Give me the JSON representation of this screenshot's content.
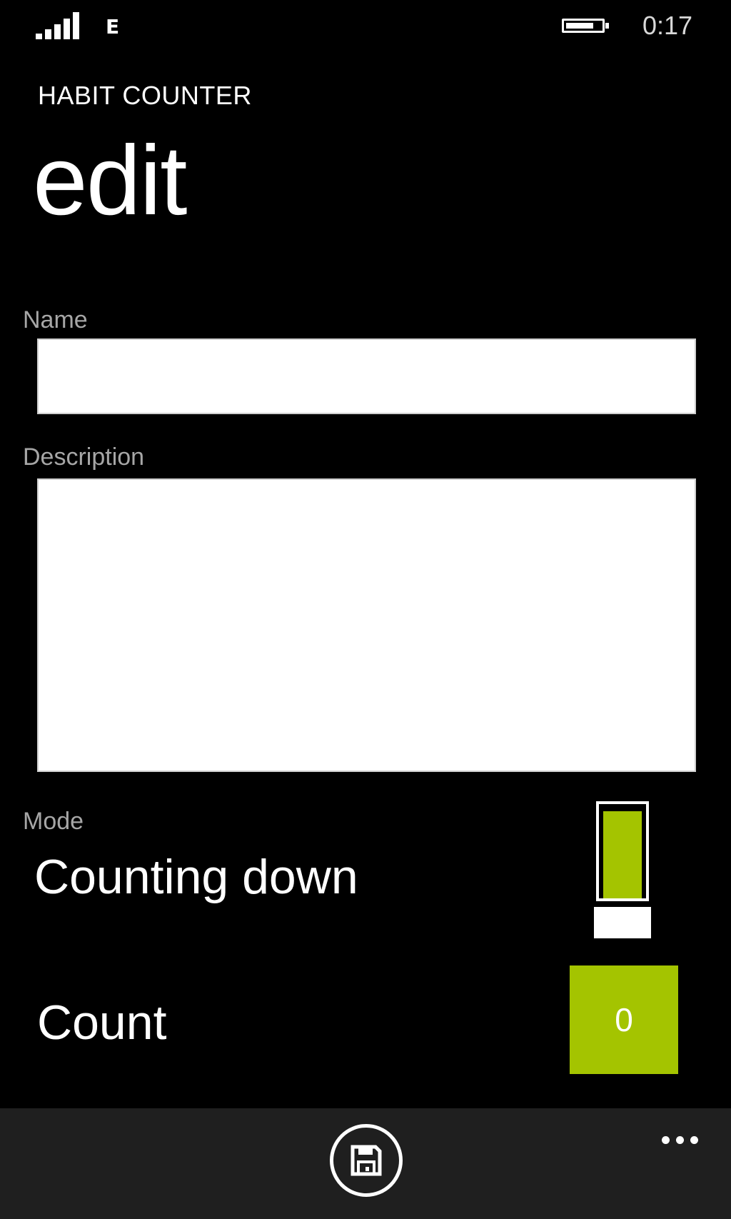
{
  "status_bar": {
    "network_type": "E",
    "time": "0:17",
    "signal_icon": "signal-strength-icon",
    "battery_icon": "battery-icon"
  },
  "header": {
    "app_title": "HABIT COUNTER",
    "page_title": "edit"
  },
  "form": {
    "name": {
      "label": "Name",
      "value": ""
    },
    "description": {
      "label": "Description",
      "value": ""
    },
    "mode": {
      "label": "Mode",
      "value": "Counting down"
    },
    "count": {
      "label": "Count",
      "value": "0"
    }
  },
  "app_bar": {
    "save_icon": "save-icon",
    "more_icon": "more-icon"
  },
  "colors": {
    "accent": "#a4c400",
    "background": "#000000",
    "app_bar": "#1f1f1f",
    "label": "#a6a6a6"
  }
}
